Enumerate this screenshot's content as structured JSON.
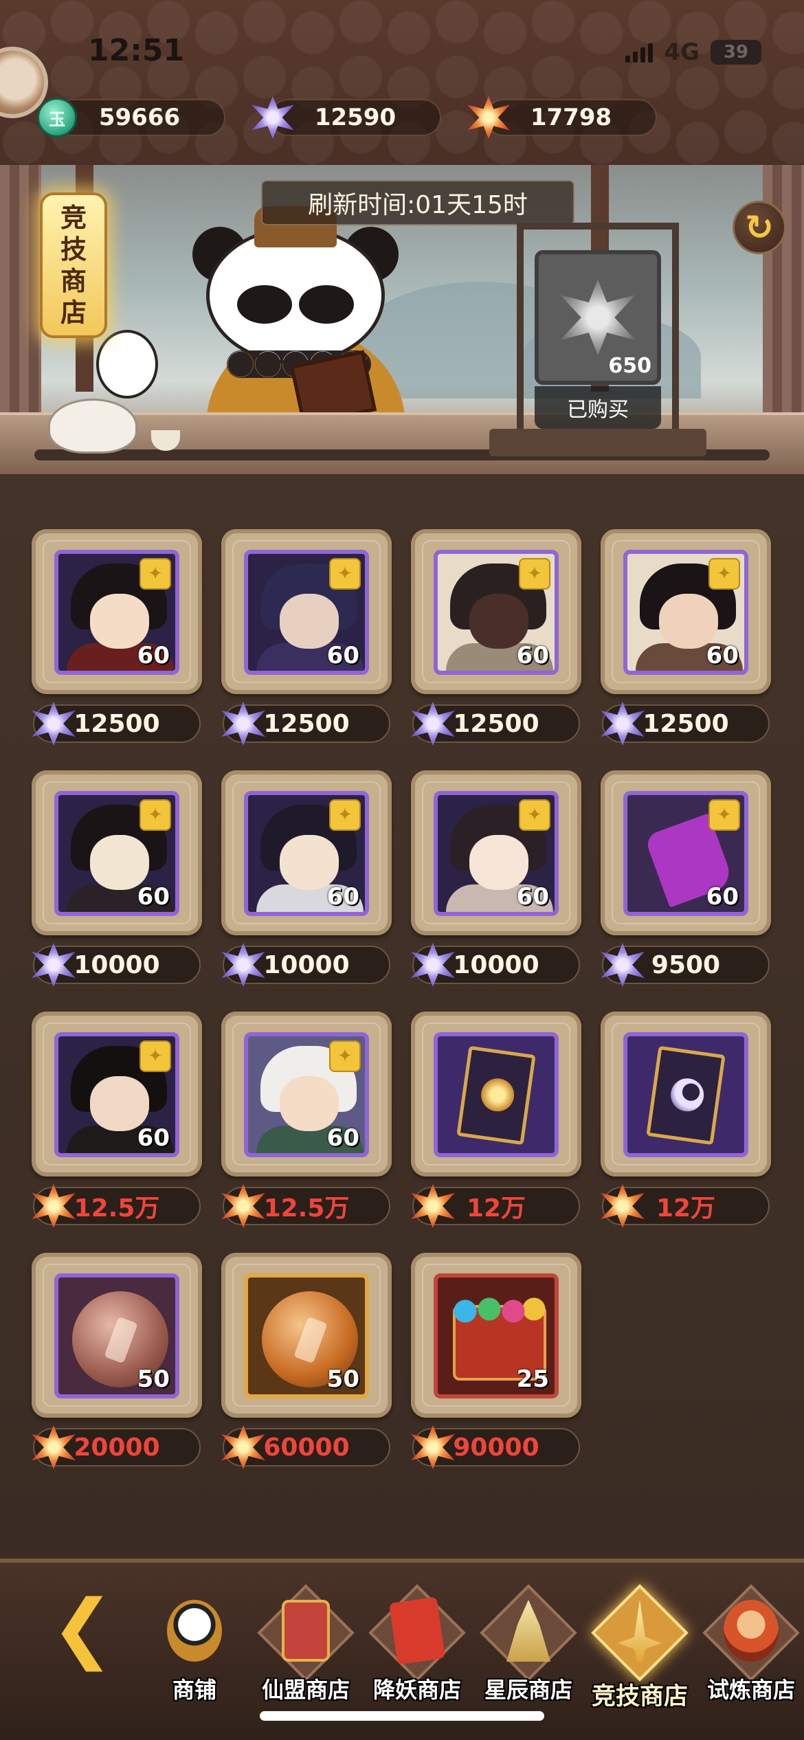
{
  "status_bar": {
    "time": "12:51",
    "network": "4G",
    "battery": "39"
  },
  "currencies": [
    {
      "icon": "jade-coin-icon",
      "glyph": "玉",
      "value": "59666"
    },
    {
      "icon": "purple-gem-icon",
      "value": "12590"
    },
    {
      "icon": "red-gem-icon",
      "value": "17798"
    }
  ],
  "banner": {
    "shop_name": [
      "竞",
      "技",
      "商",
      "店"
    ],
    "refresh_text": "刷新时间:01天15时",
    "refresh_button_icon": "refresh-icon"
  },
  "featured": {
    "quantity": "650",
    "status": "已购买",
    "icon": "gray-gem-icon"
  },
  "items": [
    {
      "type": "hero-fragment",
      "qty": "60",
      "price": "12500",
      "currency": "purple-gem-icon",
      "red": false
    },
    {
      "type": "hero-fragment",
      "qty": "60",
      "price": "12500",
      "currency": "purple-gem-icon",
      "red": false
    },
    {
      "type": "hero-fragment",
      "qty": "60",
      "price": "12500",
      "currency": "purple-gem-icon",
      "red": false
    },
    {
      "type": "hero-fragment",
      "qty": "60",
      "price": "12500",
      "currency": "purple-gem-icon",
      "red": false
    },
    {
      "type": "hero-fragment",
      "qty": "60",
      "price": "10000",
      "currency": "purple-gem-icon",
      "red": false
    },
    {
      "type": "hero-fragment",
      "qty": "60",
      "price": "10000",
      "currency": "purple-gem-icon",
      "red": false
    },
    {
      "type": "hero-fragment",
      "qty": "60",
      "price": "10000",
      "currency": "purple-gem-icon",
      "red": false
    },
    {
      "type": "glyph-fragment",
      "qty": "60",
      "price": "9500",
      "currency": "purple-gem-icon",
      "red": false
    },
    {
      "type": "hero-fragment",
      "qty": "60",
      "price": "12.5万",
      "currency": "red-gem-icon",
      "red": true
    },
    {
      "type": "hero-fragment",
      "qty": "60",
      "price": "12.5万",
      "currency": "red-gem-icon",
      "red": true
    },
    {
      "type": "sun-card",
      "qty": "",
      "price": "12万",
      "currency": "red-gem-icon",
      "red": true
    },
    {
      "type": "moon-card",
      "qty": "",
      "price": "12万",
      "currency": "red-gem-icon",
      "red": true
    },
    {
      "type": "bronze-coin",
      "qty": "50",
      "price": "20000",
      "currency": "red-gem-icon",
      "red": true
    },
    {
      "type": "amber-coin",
      "qty": "50",
      "price": "60000",
      "currency": "red-gem-icon",
      "red": true
    },
    {
      "type": "gem-chest",
      "qty": "25",
      "price": "90000",
      "currency": "red-gem-icon",
      "red": true
    }
  ],
  "nav": [
    {
      "label": "商铺",
      "icon": "panda-shop-icon",
      "active": false
    },
    {
      "label": "仙盟商店",
      "icon": "alliance-shop-icon",
      "active": false
    },
    {
      "label": "降妖商店",
      "icon": "demon-shop-icon",
      "active": false
    },
    {
      "label": "星辰商店",
      "icon": "star-shop-icon",
      "active": false
    },
    {
      "label": "竞技商店",
      "icon": "arena-shop-icon",
      "active": true
    },
    {
      "label": "试炼商店",
      "icon": "trial-shop-icon",
      "active": false
    }
  ]
}
